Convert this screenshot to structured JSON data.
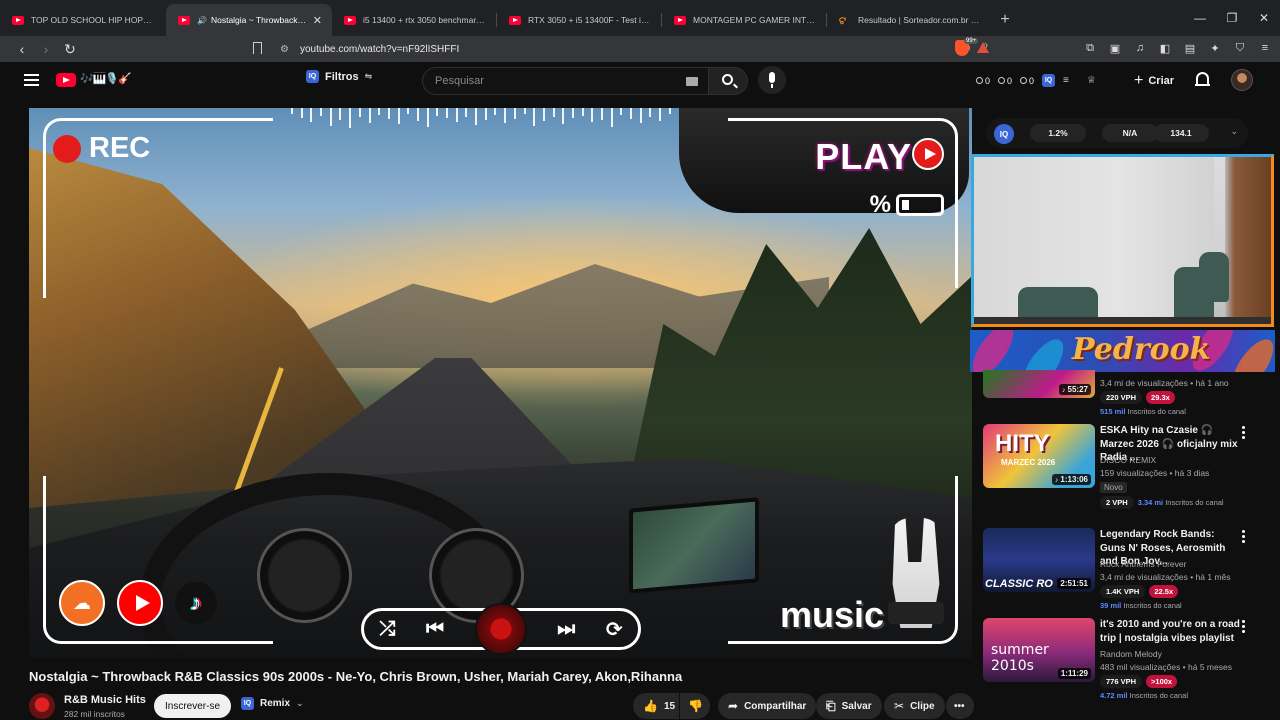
{
  "browser": {
    "tabs": [
      {
        "title": "TOP OLD SCHOOL HIP HOP🔥🔥 Ice",
        "active": false,
        "muted": false
      },
      {
        "title": "Nostalgia ~ Throwback R&B C",
        "active": true,
        "muted": true
      },
      {
        "title": "i5 13400 + rtx 3050 benchmark - You",
        "active": false,
        "muted": false
      },
      {
        "title": "RTX 3050 + i5 13400F - Test in 18 Ga",
        "active": false,
        "muted": false
      },
      {
        "title": "MONTAGEM PC GAMER INTEL GIGA",
        "active": false,
        "muted": false
      },
      {
        "title": "Resultado | Sorteador.com.br - O Site",
        "active": false,
        "muted": false
      }
    ],
    "url": "youtube.com/watch?v=nF92lISHFFI",
    "brave_badge": "99+"
  },
  "header": {
    "filters_label": "Filtros",
    "search_placeholder": "Pesquisar",
    "stats": [
      "0",
      "0",
      "0"
    ],
    "create_label": "Criar",
    "logo_deco": "🎶🎹🎙️🎸"
  },
  "overlay": {
    "rec": "REC",
    "play": "PLAY",
    "percent": "%",
    "music": "music"
  },
  "video": {
    "title": "Nostalgia ~ Throwback R&B Classics 90s 2000s - Ne-Yo, Chris Brown, Usher, Mariah Carey, Akon,Rihanna",
    "channel": "R&B Music Hits",
    "subscribers": "282 mil inscritos",
    "subscribe_label": "Inscrever-se",
    "remix_label": "Remix",
    "likes": "15",
    "share_label": "Compartilhar",
    "save_label": "Salvar",
    "clip_label": "Clipe"
  },
  "sidebar": {
    "metrics": [
      "1.2%",
      "N/A",
      "134.1"
    ],
    "banner_text": "Pedrook",
    "recommendations": [
      {
        "title": "",
        "channel": "",
        "meta": "3,4 mi de visualizações • há 1 ano",
        "duration": "55:27",
        "vph": "220 VPH",
        "mult": "29.3x",
        "mult_color": "#c0143c",
        "subs_num": "515 mil",
        "subs_label": "Inscritos do canal",
        "badge_new": "",
        "thumb_text": ""
      },
      {
        "title": "ESKA Hity na Czasie 🎧 Marzec 2026 🎧 oficjalny mix Radia ...",
        "channel": "DISCO REMIX",
        "meta": "159 visualizações • há 3 dias",
        "duration": "1:13:06",
        "vph": "2 VPH",
        "mult": "",
        "mult_color": "",
        "subs_num": "3.34 mi",
        "subs_label": "Inscritos do canal",
        "badge_new": "Novo",
        "thumb_text": "HITY",
        "thumb_sub": "MARZEC 2026"
      },
      {
        "title": "Legendary Rock Bands: Guns N' Roses, Aerosmith and Bon Jov...",
        "channel": "Rock Anthems Forever",
        "meta": "3,4 mi de visualizações • há 1 mês",
        "duration": "2:51:51",
        "vph": "1.4K VPH",
        "mult": "22.5x",
        "mult_color": "#c0143c",
        "subs_num": "39 mil",
        "subs_label": "Inscritos do canal",
        "badge_new": "",
        "thumb_text": "CLASSIC RO"
      },
      {
        "title": "it's 2010 and you're on a road trip | nostalgia vibes playlist",
        "channel": "Random Melody",
        "meta": "483 mil visualizações • há 5 meses",
        "duration": "1:11:29",
        "vph": "776 VPH",
        "mult": ">100x",
        "mult_color": "#c0143c",
        "subs_num": "4.72 mil",
        "subs_label": "Inscritos do canal",
        "badge_new": "",
        "thumb_text": "summer 2010s"
      }
    ]
  },
  "colors": {
    "youtube_red": "#ff0033",
    "accent_blue": "#3a66d6",
    "webcam_border_orange": "#f38a1c",
    "webcam_border_blue": "#37a8e0"
  }
}
